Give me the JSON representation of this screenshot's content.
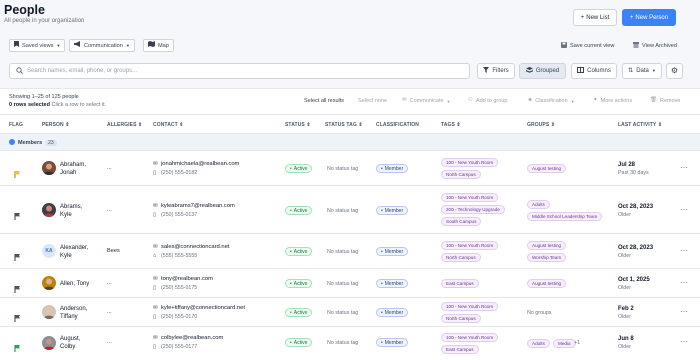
{
  "page": {
    "title": "People",
    "subtitle": "All people in your organization"
  },
  "header_actions": {
    "new_list": "New List",
    "new_person": "New Person"
  },
  "toolbar": {
    "saved_views": "Saved views",
    "communication": "Communication",
    "map": "Map",
    "save_current_view": "Save current view",
    "view_archived": "View Archived"
  },
  "search": {
    "placeholder": "Search names, email, phone, or groups..."
  },
  "filters": {
    "filters": "Filters",
    "grouped": "Grouped",
    "columns": "Columns",
    "data": "Data"
  },
  "selection": {
    "showing": "Showing 1–25 of 125 people",
    "rows_selected": "0 rows selected",
    "hint": "Click a row to select it.",
    "select_all": "Select all results",
    "select_none": "Select none",
    "communicate": "Communicate",
    "add_to_group": "Add to group",
    "classification": "Classification",
    "more_actions": "More actions",
    "remove": "Remove"
  },
  "columns": [
    "FLAG",
    "PERSON",
    "ALLERGIES",
    "CONTACT",
    "STATUS",
    "STATUS TAG",
    "CLASSIFICATION",
    "TAGS",
    "GROUPS",
    "LAST ACTIVITY"
  ],
  "group": {
    "label": "Members",
    "count": "23"
  },
  "colors": {
    "accent": "#3b82f6",
    "flag_yellow": "#f5c518",
    "flag_green": "#22a85a",
    "flag_gray": "#4b5563"
  },
  "rows": [
    {
      "first": "Abraham,",
      "last": "Jonah",
      "allergies": "...",
      "email": "jonahmichaela@realbean.com",
      "phone": "(250) 555-0182",
      "status": "Active",
      "status_tag": "No status tag",
      "classification": "Member",
      "tags": [
        "100 - New Youth Room",
        "North Campus"
      ],
      "groups": [
        "August testing"
      ],
      "date": "Jul 28",
      "date_sub": "Past 30 days",
      "flag": "yellow"
    },
    {
      "first": "Abrams,",
      "last": "Kyle",
      "allergies": "...",
      "email": "kyleabrams7@realbean.com",
      "phone": "(250) 555-0137",
      "status": "Active",
      "status_tag": "No status tag",
      "classification": "Member",
      "tags": [
        "100 - New Youth Room",
        "200 - Technology Upgrade",
        "South Campus"
      ],
      "groups": [
        "Adults",
        "Middle School Leadership Team"
      ],
      "date": "Oct 28, 2023",
      "date_sub": "Older",
      "flag": "gray"
    },
    {
      "first": "Alexander,",
      "last": "Kyle",
      "initials": "KA",
      "allergies": "Bees",
      "email": "sales@connectioncard.net",
      "phone": "(555) 555-5555",
      "status": "Active",
      "status_tag": "No status tag",
      "classification": "Member",
      "tags": [
        "100 - New Youth Room",
        "North Campus"
      ],
      "groups": [
        "August testing",
        "Worship Team"
      ],
      "date": "Oct 28, 2023",
      "date_sub": "Older",
      "flag": "gray"
    },
    {
      "first": "Allen, Tony",
      "last": "",
      "allergies": "...",
      "email": "tony@realbean.com",
      "phone": "(250) 555-0175",
      "status": "Active",
      "status_tag": "No status tag",
      "classification": "Member",
      "tags": [
        "East Campus"
      ],
      "groups": [
        "August testing"
      ],
      "date": "Oct 1, 2025",
      "date_sub": "Older",
      "flag": "gray"
    },
    {
      "first": "Anderson,",
      "last": "Tiffany",
      "allergies": "...",
      "email": "kyle+tiffany@connectioncard.net",
      "phone": "(250) 555-0170",
      "status": "Active",
      "status_tag": "No status tag",
      "classification": "Member",
      "tags": [
        "100 - New Youth Room",
        "North Campus"
      ],
      "groups_text": "No groups",
      "date": "Feb 2",
      "date_sub": "Older",
      "flag": "gray"
    },
    {
      "first": "August,",
      "last": "Colby",
      "allergies": "...",
      "email": "colbylee@realbean.com",
      "phone": "(250) 555-0177",
      "status": "Active",
      "status_tag": "No status tag",
      "classification": "Member",
      "tags": [
        "100 - New Youth Room",
        "East Campus"
      ],
      "groups": [
        "Adults",
        "Media"
      ],
      "groups_more": "+1",
      "date": "Jun 8",
      "date_sub": "Older",
      "flag": "green"
    }
  ]
}
